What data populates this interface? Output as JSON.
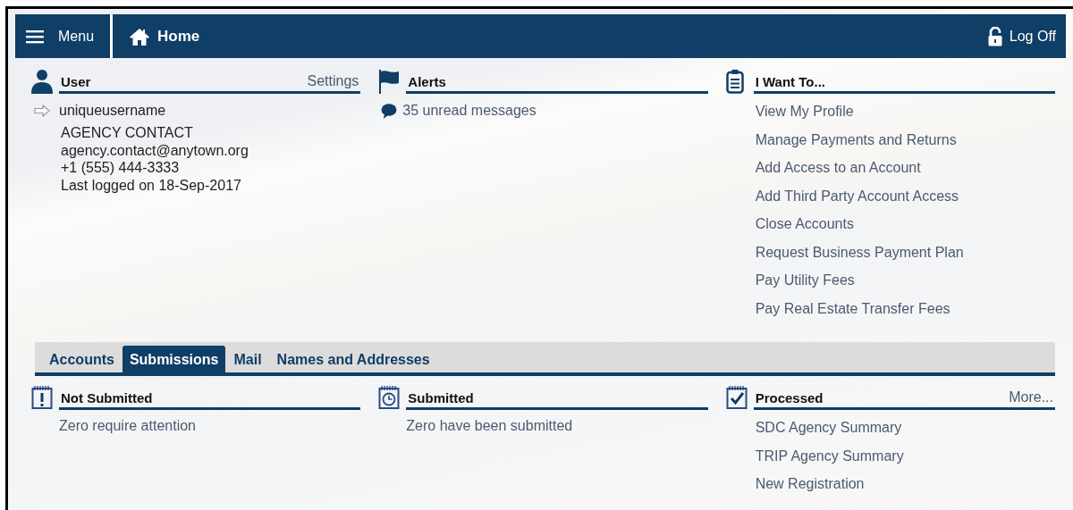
{
  "nav": {
    "menu_label": "Menu",
    "home_label": "Home",
    "logoff_label": "Log Off"
  },
  "top_panels": [
    {
      "kind": "user",
      "title": "User",
      "action": "Settings",
      "username": "uniqueusername",
      "details": [
        "AGENCY CONTACT",
        "agency.contact@anytown.org",
        "+1 (555) 444-3333",
        "Last logged on 18-Sep-2017"
      ]
    },
    {
      "kind": "alerts",
      "title": "Alerts",
      "message": "35 unread messages"
    },
    {
      "kind": "links",
      "title": "I Want To...",
      "links": [
        "View My Profile",
        "Manage Payments and Returns",
        "Add Access to an Account",
        "Add Third Party Account Access",
        "Close Accounts",
        "Request Business Payment Plan",
        "Pay Utility Fees",
        "Pay Real Estate Transfer Fees"
      ]
    }
  ],
  "tabs": [
    {
      "label": "Accounts",
      "selected": false
    },
    {
      "label": "Submissions",
      "selected": true
    },
    {
      "label": "Mail",
      "selected": false
    },
    {
      "label": "Names and Addresses",
      "selected": false
    }
  ],
  "tab_panels": [
    {
      "kind": "text",
      "title": "Not Submitted",
      "text": "Zero require attention"
    },
    {
      "kind": "text",
      "title": "Submitted",
      "text": "Zero have been submitted"
    },
    {
      "kind": "links",
      "title": "Processed",
      "action": "More...",
      "links": [
        "SDC Agency Summary",
        "TRIP Agency Summary",
        "New Registration"
      ]
    }
  ]
}
